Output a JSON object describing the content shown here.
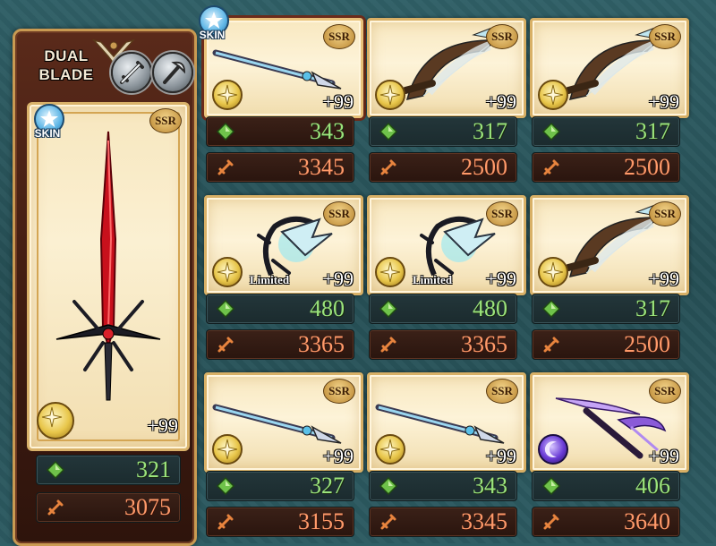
{
  "main": {
    "type_label_line1": "DUAL",
    "type_label_line2": "BLADE",
    "skin_label": "SKIN",
    "rarity": "SSR",
    "plus": "+99",
    "element": "light",
    "hp": "321",
    "atk": "3075"
  },
  "grid": [
    {
      "rarity": "SSR",
      "plus": "+99",
      "element": "light",
      "hp": "343",
      "atk": "3345",
      "skin": true,
      "skin_label": "SKIN",
      "limited": "",
      "art": "spear-blue",
      "selected": true
    },
    {
      "rarity": "SSR",
      "plus": "+99",
      "element": "light",
      "hp": "317",
      "atk": "2500",
      "skin": false,
      "limited": "",
      "art": "harp"
    },
    {
      "rarity": "SSR",
      "plus": "+99",
      "element": "light",
      "hp": "317",
      "atk": "2500",
      "skin": false,
      "limited": "",
      "art": "harp"
    },
    {
      "rarity": "SSR",
      "plus": "+99",
      "element": "light",
      "hp": "480",
      "atk": "3365",
      "skin": false,
      "limited": "Limited",
      "art": "gauntlet"
    },
    {
      "rarity": "SSR",
      "plus": "+99",
      "element": "light",
      "hp": "480",
      "atk": "3365",
      "skin": false,
      "limited": "Limited",
      "art": "gauntlet"
    },
    {
      "rarity": "SSR",
      "plus": "+99",
      "element": "light",
      "hp": "317",
      "atk": "2500",
      "skin": false,
      "limited": "",
      "art": "harp"
    },
    {
      "rarity": "SSR",
      "plus": "+99",
      "element": "light",
      "hp": "327",
      "atk": "3155",
      "skin": false,
      "limited": "",
      "art": "spear-blue"
    },
    {
      "rarity": "SSR",
      "plus": "+99",
      "element": "light",
      "hp": "343",
      "atk": "3345",
      "skin": false,
      "limited": "",
      "art": "spear-blue"
    },
    {
      "rarity": "SSR",
      "plus": "+99",
      "element": "dark",
      "hp": "406",
      "atk": "3640",
      "skin": false,
      "limited": "",
      "art": "scythe-purple"
    }
  ],
  "colors": {
    "hp": "#9be47c",
    "atk": "#ff9a6a",
    "frame": "#d8b066",
    "bg": "#2f5f66"
  }
}
